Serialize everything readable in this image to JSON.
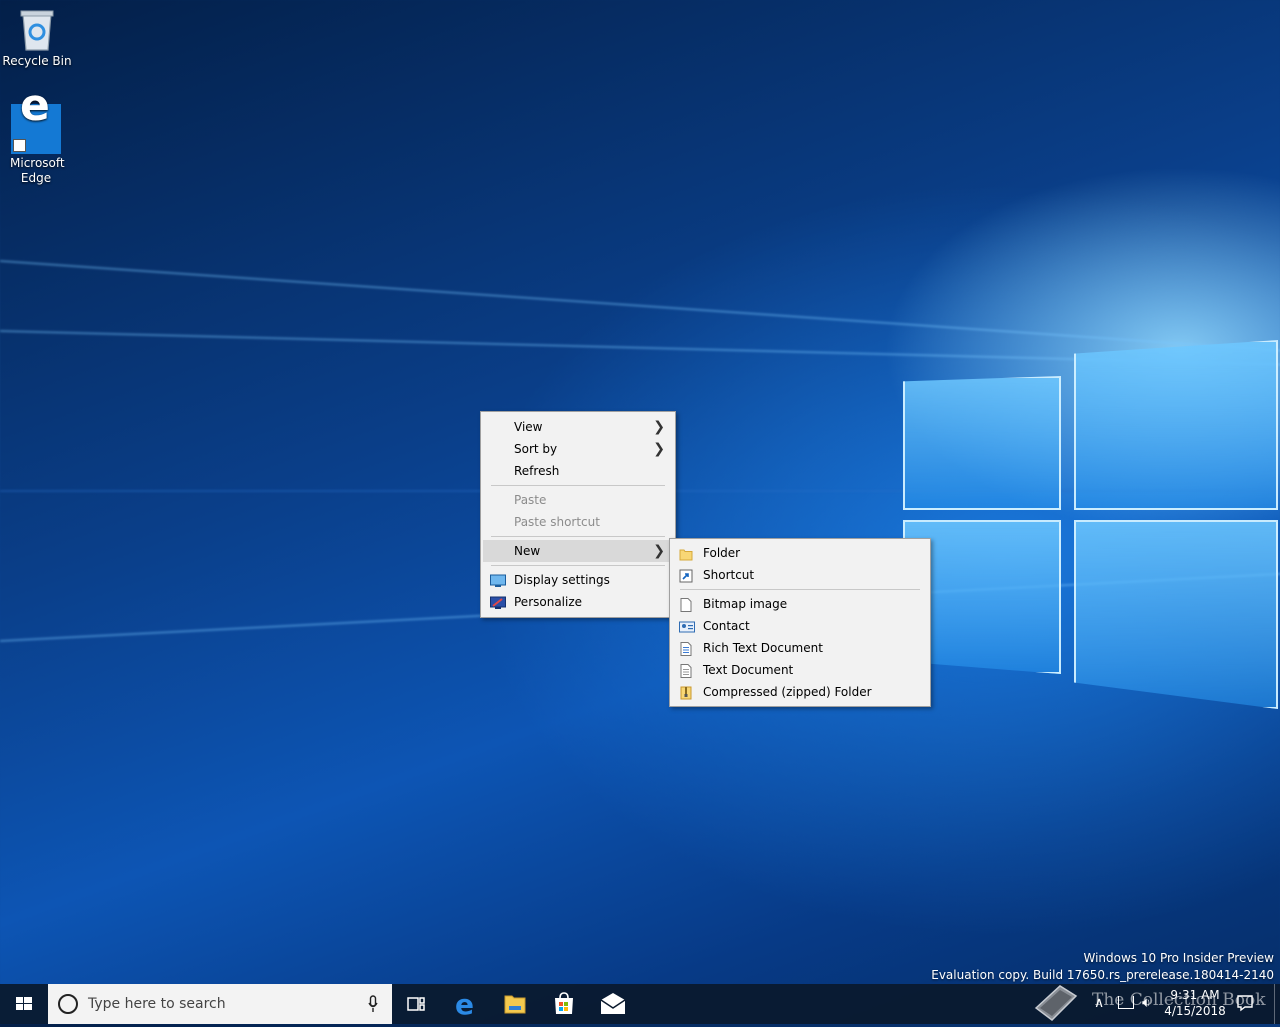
{
  "desktop": {
    "icons": [
      {
        "label": "Recycle Bin",
        "icon": "recycle-bin-icon"
      },
      {
        "label": "Microsoft Edge",
        "icon": "edge-icon"
      }
    ],
    "watermark_line1": "Windows 10 Pro Insider Preview",
    "watermark_line2": "Evaluation copy. Build 17650.rs_prerelease.180414-2140",
    "collection_book_text": "The Collection Book"
  },
  "context_menu": {
    "items": [
      {
        "label": "View",
        "submenu": true
      },
      {
        "label": "Sort by",
        "submenu": true
      },
      {
        "label": "Refresh"
      },
      {
        "label": "Paste",
        "disabled": true
      },
      {
        "label": "Paste shortcut",
        "disabled": true
      },
      {
        "label": "New",
        "submenu": true,
        "highlighted": true
      },
      {
        "label": "Display settings",
        "icon": "display-settings-icon"
      },
      {
        "label": "Personalize",
        "icon": "personalize-icon"
      }
    ]
  },
  "new_submenu": {
    "items": [
      {
        "label": "Folder",
        "icon": "folder-icon"
      },
      {
        "label": "Shortcut",
        "icon": "shortcut-icon"
      },
      {
        "label": "Bitmap image",
        "icon": "bitmap-icon"
      },
      {
        "label": "Contact",
        "icon": "contact-icon"
      },
      {
        "label": "Rich Text Document",
        "icon": "rich-text-icon"
      },
      {
        "label": "Text Document",
        "icon": "text-document-icon"
      },
      {
        "label": "Compressed (zipped) Folder",
        "icon": "zip-folder-icon"
      }
    ]
  },
  "taskbar": {
    "search_placeholder": "Type here to search",
    "pinned": [
      "task-view-icon",
      "edge-icon",
      "file-explorer-icon",
      "store-icon",
      "mail-icon"
    ],
    "clock_time": "9:31 AM",
    "clock_date": "4/15/2018"
  },
  "colors": {
    "accent": "#0078d7",
    "menu_bg": "#f2f2f2",
    "taskbar_bg": "#0a192d"
  }
}
